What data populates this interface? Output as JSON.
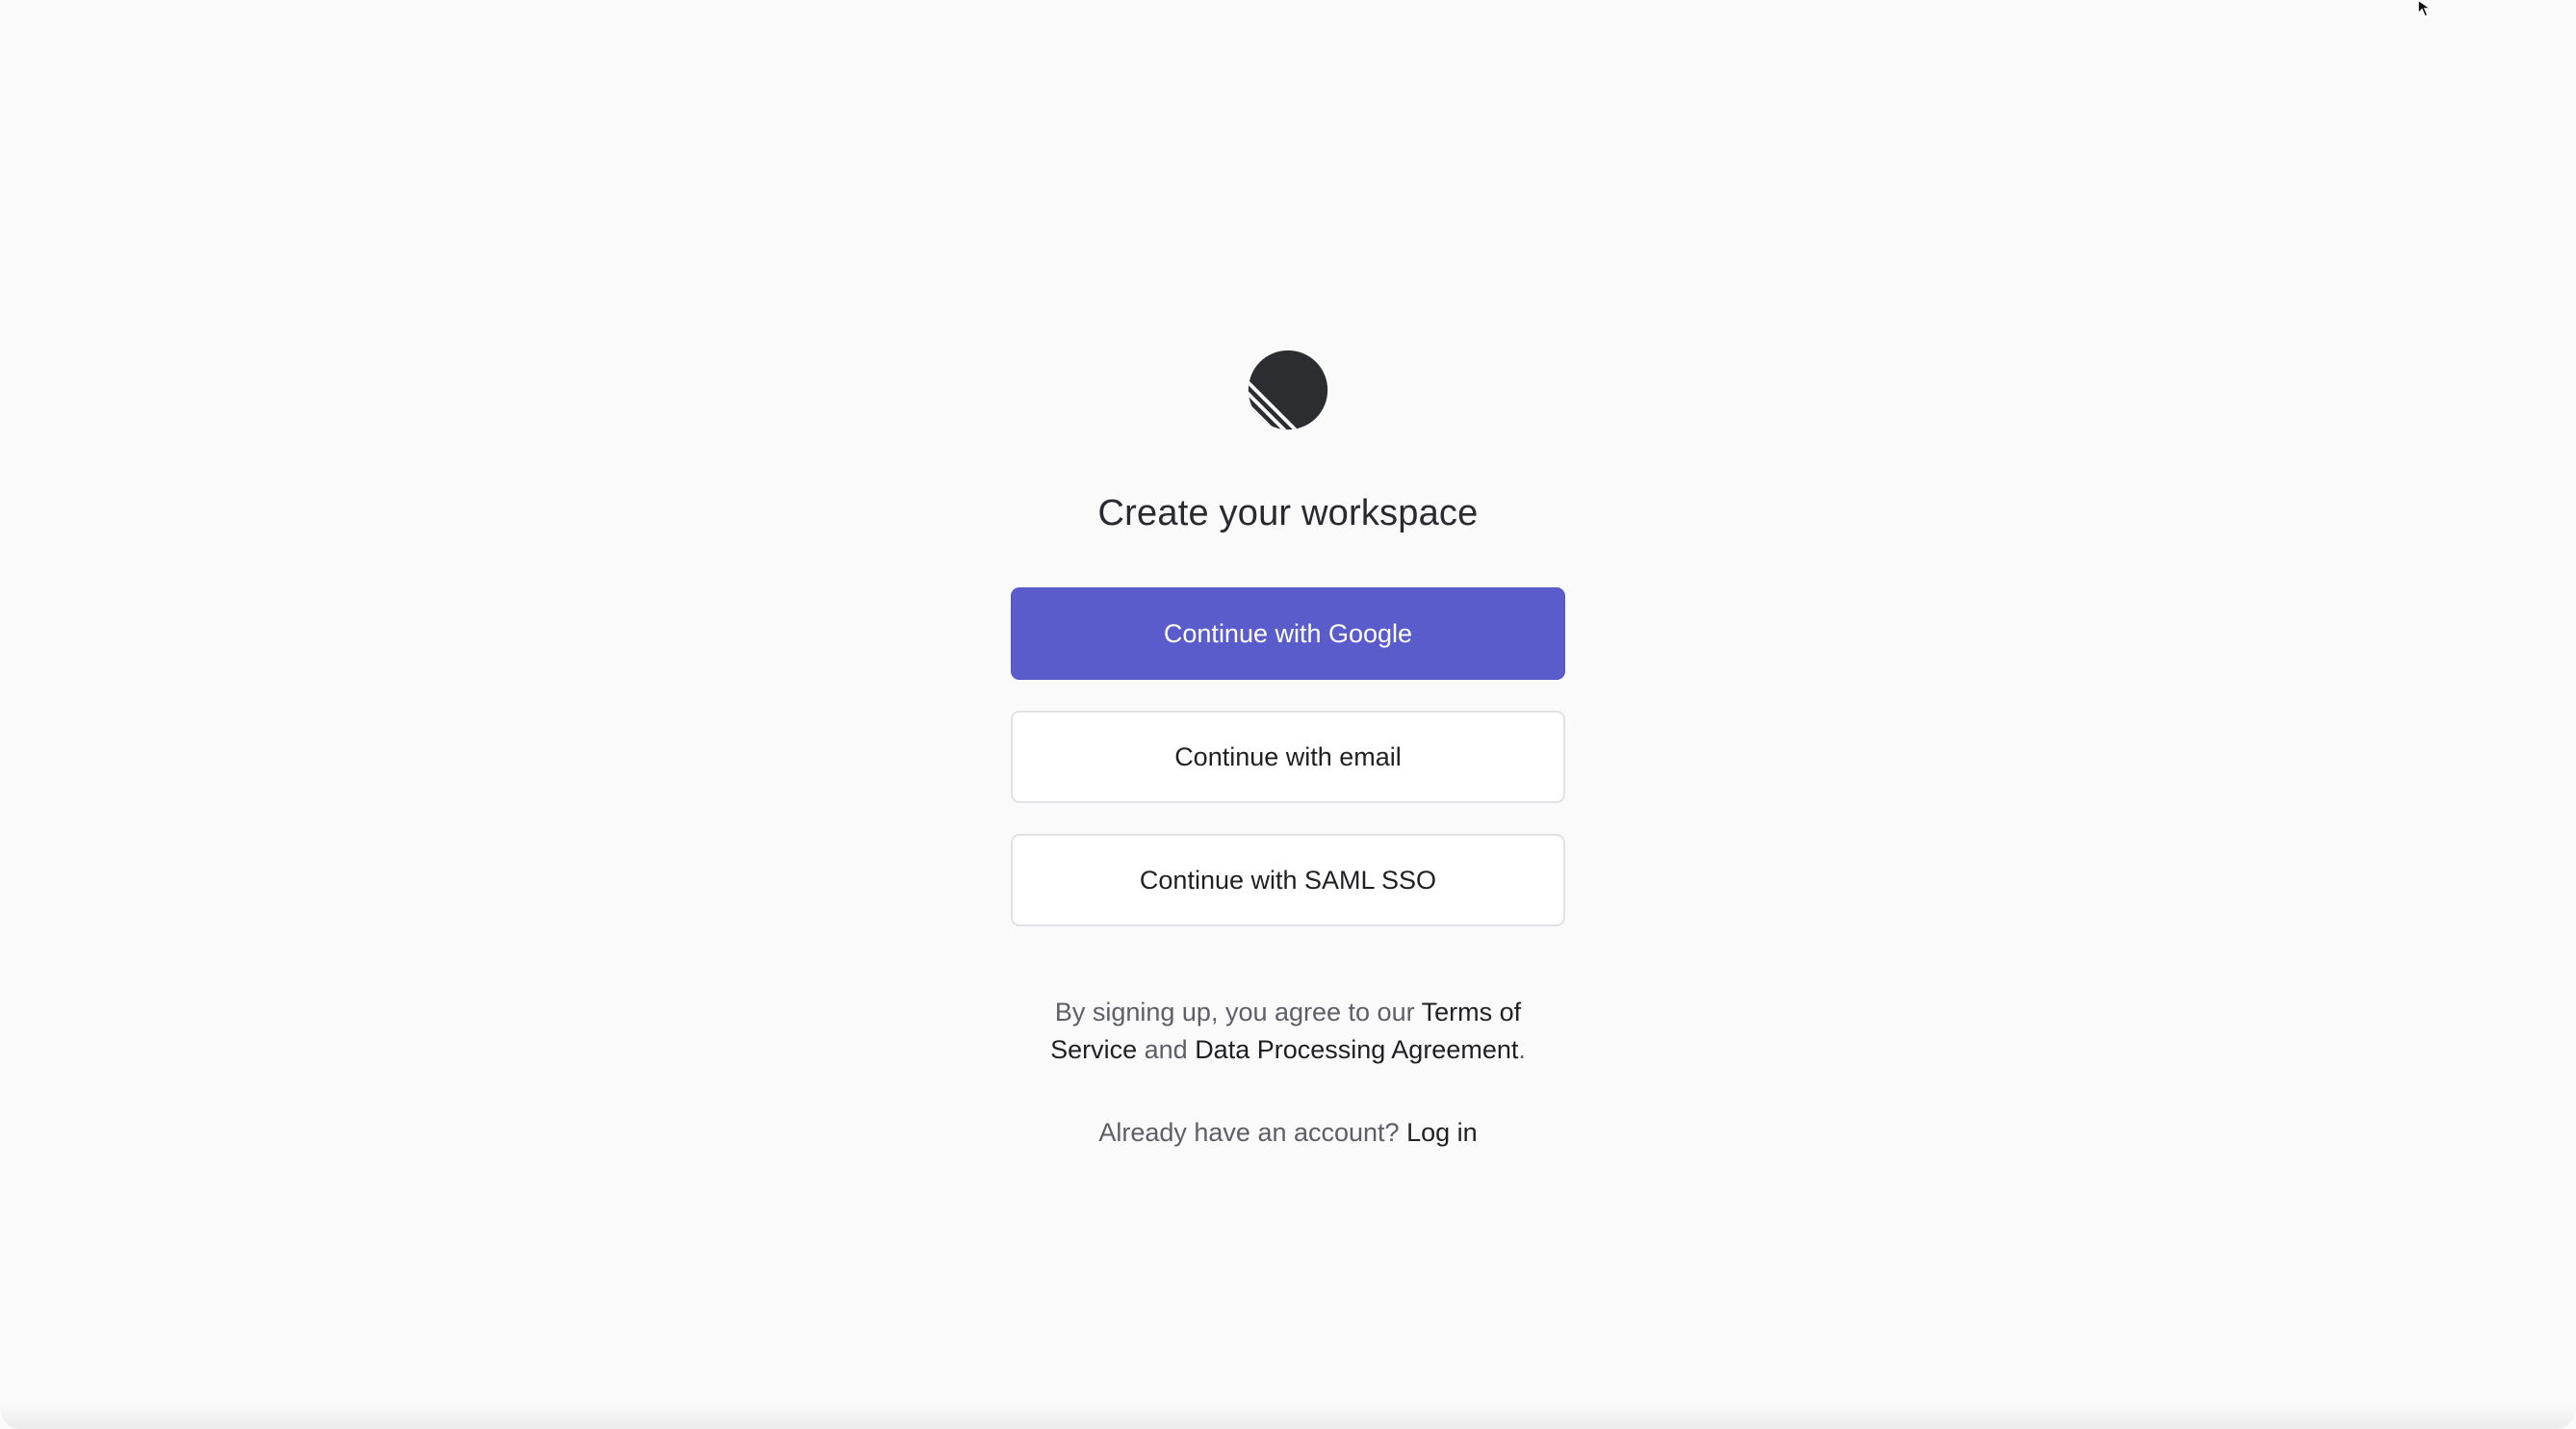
{
  "brand": {
    "logo_icon": "linear-logo-icon",
    "accent_color": "#5a5ccc"
  },
  "page": {
    "title": "Create your workspace"
  },
  "buttons": {
    "google": "Continue with Google",
    "email": "Continue with email",
    "saml": "Continue with SAML SSO"
  },
  "legal": {
    "prefix": "By signing up, you agree to our ",
    "terms_link": "Terms of Service",
    "middle": " and ",
    "dpa_link": "Data Processing Agreement",
    "suffix": "."
  },
  "login": {
    "prompt": "Already have an account? ",
    "link": "Log in"
  }
}
